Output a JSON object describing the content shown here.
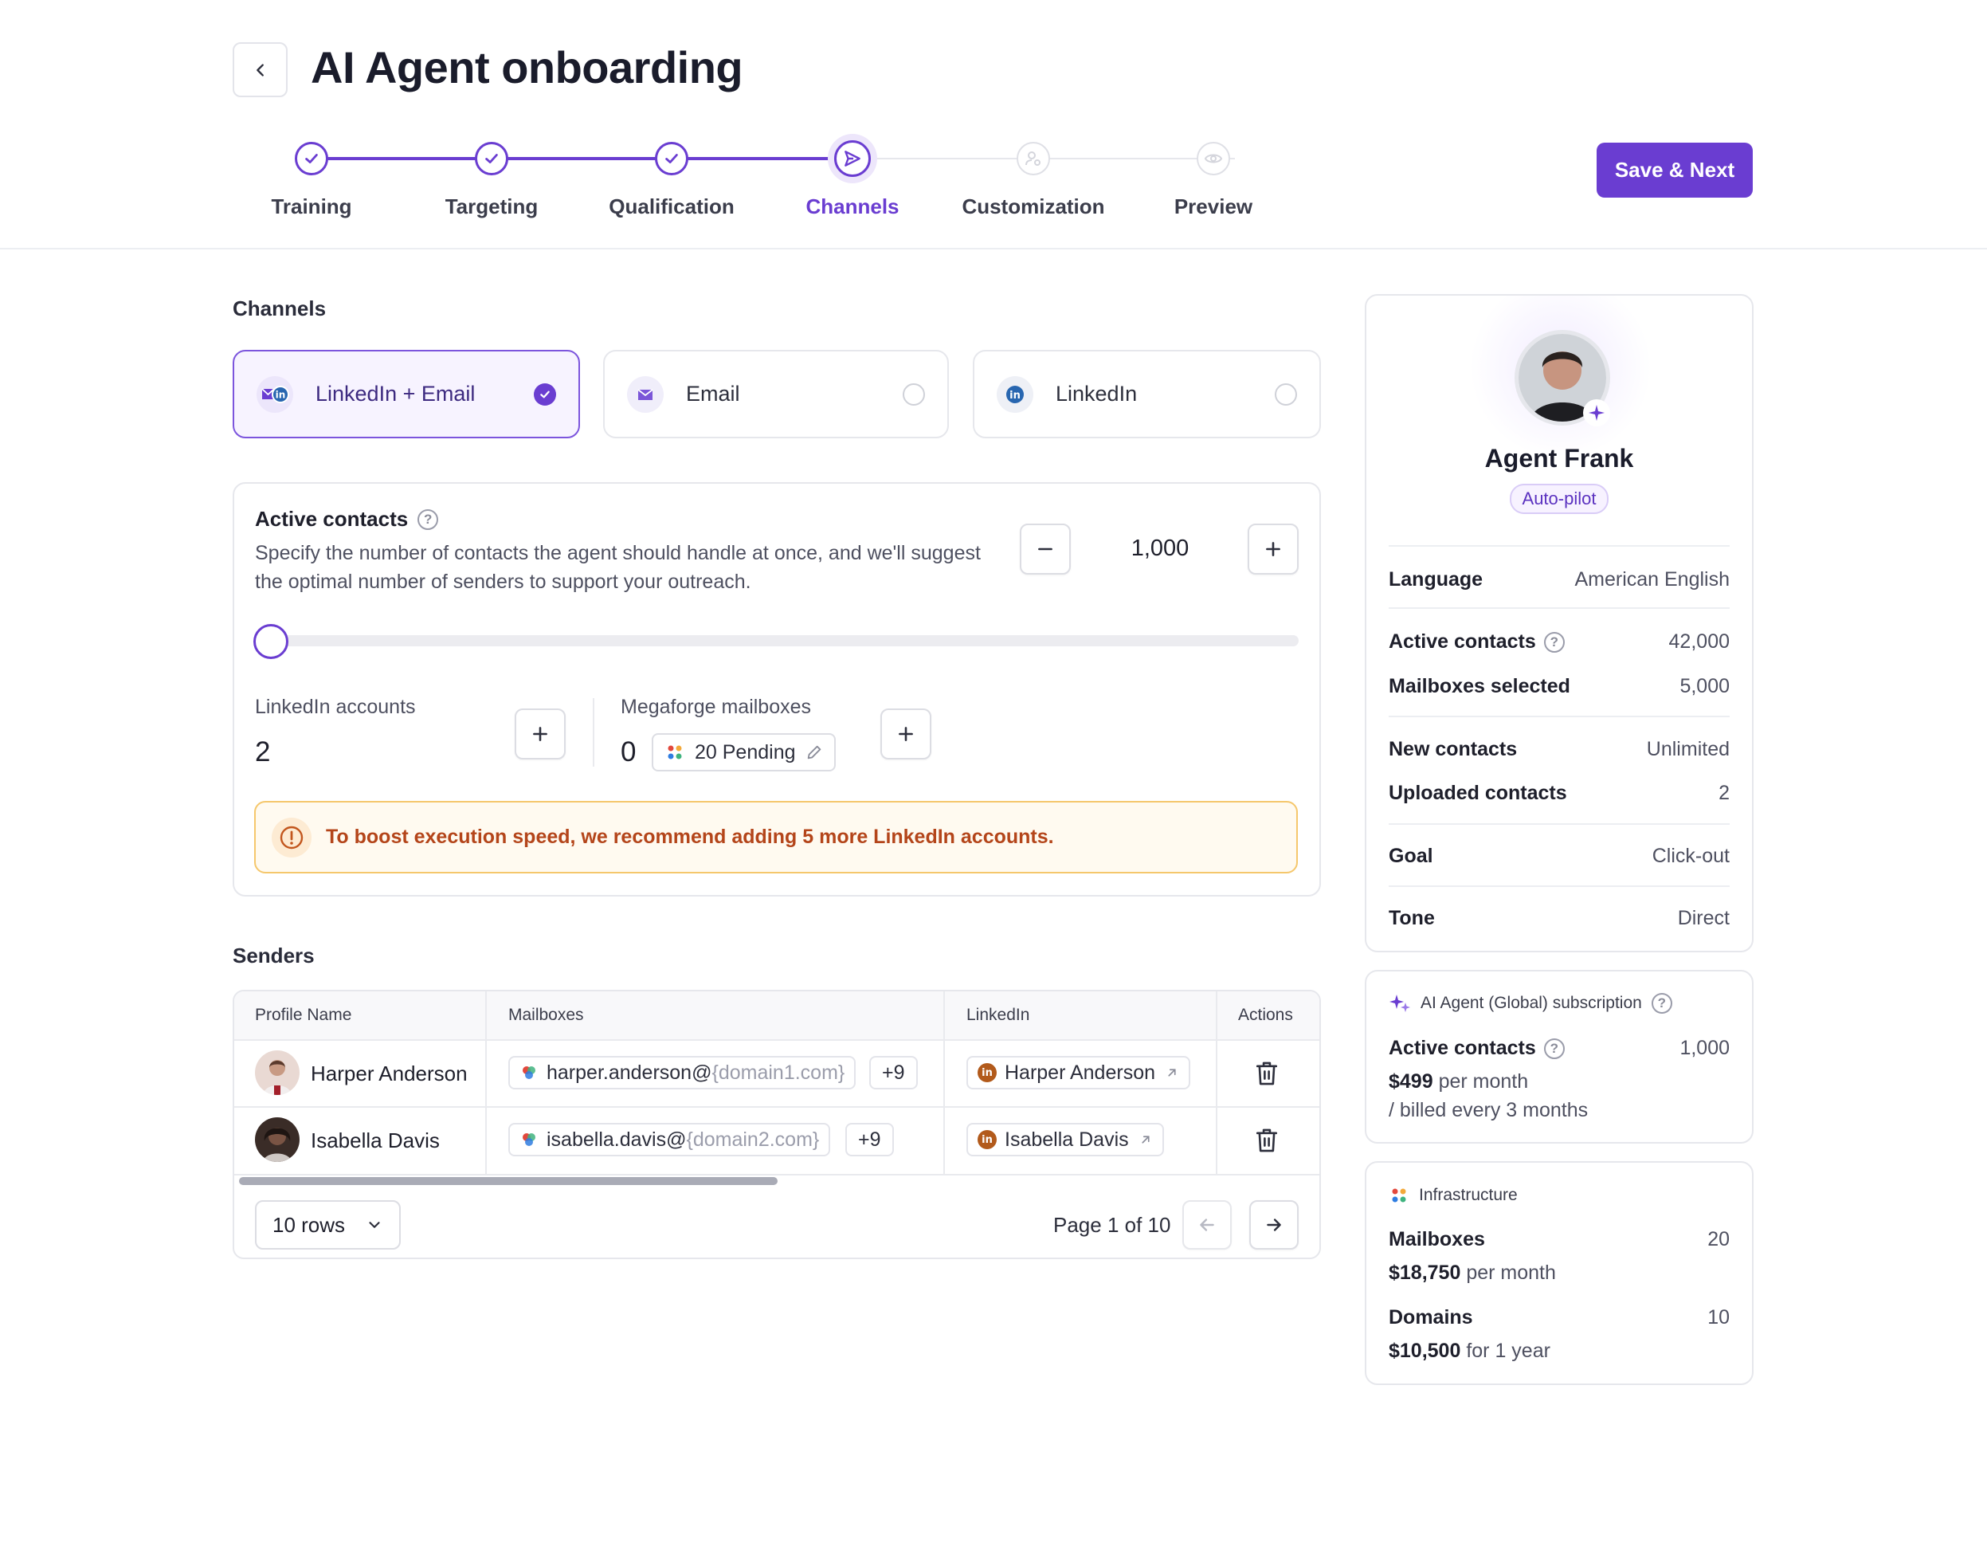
{
  "header": {
    "title": "AI Agent onboarding",
    "save_label": "Save & Next"
  },
  "steps": [
    {
      "label": "Training",
      "state": "done"
    },
    {
      "label": "Targeting",
      "state": "done"
    },
    {
      "label": "Qualification",
      "state": "done"
    },
    {
      "label": "Channels",
      "state": "current"
    },
    {
      "label": "Customization",
      "state": "future"
    },
    {
      "label": "Preview",
      "state": "future"
    }
  ],
  "channels": {
    "section_label": "Channels",
    "options": [
      {
        "label": "LinkedIn + Email",
        "selected": true
      },
      {
        "label": "Email",
        "selected": false
      },
      {
        "label": "LinkedIn",
        "selected": false
      }
    ]
  },
  "active_contacts": {
    "title": "Active contacts",
    "description": "Specify the number of contacts the agent should handle at once, and we'll suggest the optimal number of senders to support your outreach.",
    "value": "1,000",
    "slider_fraction": 0
  },
  "accounts": {
    "linkedin_label": "LinkedIn accounts",
    "linkedin_value": "2",
    "mailboxes_label": "Megaforge mailboxes",
    "mailboxes_value": "0",
    "pending_label": "20 Pending"
  },
  "alert": {
    "text": "To boost execution speed, we recommend adding 5 more LinkedIn accounts."
  },
  "senders": {
    "section_label": "Senders",
    "columns": [
      "Profile Name",
      "Mailboxes",
      "LinkedIn",
      "Actions"
    ],
    "rows": [
      {
        "name": "Harper Anderson",
        "mail_user": "harper.anderson@",
        "mail_domain": "{domain1.com}",
        "more": "+9",
        "linkedin": "Harper Anderson"
      },
      {
        "name": "Isabella Davis",
        "mail_user": "isabella.davis@",
        "mail_domain": "{domain2.com}",
        "more": "+9",
        "linkedin": "Isabella Davis"
      }
    ],
    "rows_select": "10 rows",
    "page_text": "Page 1 of 10"
  },
  "agent": {
    "name": "Agent Frank",
    "mode": "Auto-pilot",
    "details": [
      {
        "key": "Language",
        "value": "American English"
      },
      {
        "key": "Active contacts",
        "value": "42,000"
      },
      {
        "key": "Mailboxes selected",
        "value": "5,000"
      },
      {
        "key": "New contacts",
        "value": "Unlimited"
      },
      {
        "key": "Uploaded contacts",
        "value": "2"
      },
      {
        "key": "Goal",
        "value": "Click-out"
      },
      {
        "key": "Tone",
        "value": "Direct"
      }
    ]
  },
  "subscription": {
    "title": "AI Agent (Global) subscription",
    "contacts_label": "Active contacts",
    "contacts_value": "1,000",
    "price": "$499",
    "price_suffix": "per month",
    "billing": "/ billed every 3 months"
  },
  "infrastructure": {
    "title": "Infrastructure",
    "mailboxes_label": "Mailboxes",
    "mailboxes_value": "20",
    "mailboxes_price": "$18,750",
    "mailboxes_suffix": "per month",
    "domains_label": "Domains",
    "domains_value": "10",
    "domains_price": "$10,500",
    "domains_suffix": "for 1 year"
  },
  "colors": {
    "accent": "#6a3dd1",
    "alert_text": "#b4451a",
    "alert_border": "#f5c76c"
  }
}
